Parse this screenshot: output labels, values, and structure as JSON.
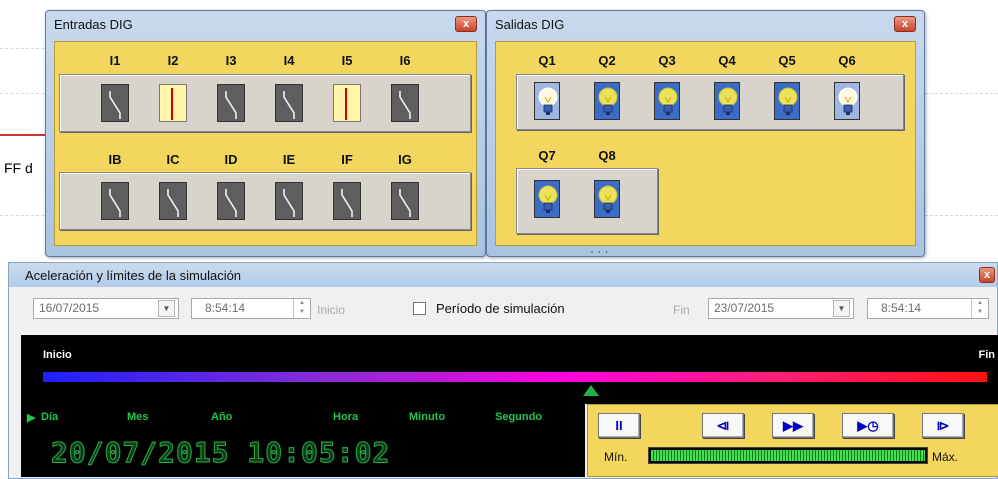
{
  "background": {
    "fragment_text": "FF d"
  },
  "inputs_window": {
    "title": "Entradas DIG",
    "close_label": "x",
    "row1": [
      {
        "label": "I1",
        "state": "off"
      },
      {
        "label": "I2",
        "state": "on"
      },
      {
        "label": "I3",
        "state": "off"
      },
      {
        "label": "I4",
        "state": "off"
      },
      {
        "label": "I5",
        "state": "on"
      },
      {
        "label": "I6",
        "state": "off"
      }
    ],
    "row2": [
      {
        "label": "IB",
        "state": "off"
      },
      {
        "label": "IC",
        "state": "off"
      },
      {
        "label": "ID",
        "state": "off"
      },
      {
        "label": "IE",
        "state": "off"
      },
      {
        "label": "IF",
        "state": "off"
      },
      {
        "label": "IG",
        "state": "off"
      }
    ]
  },
  "outputs_window": {
    "title": "Salidas DIG",
    "close_label": "x",
    "row1": [
      {
        "label": "Q1",
        "state": "on"
      },
      {
        "label": "Q2",
        "state": "off"
      },
      {
        "label": "Q3",
        "state": "off"
      },
      {
        "label": "Q4",
        "state": "off"
      },
      {
        "label": "Q5",
        "state": "off"
      },
      {
        "label": "Q6",
        "state": "on"
      }
    ],
    "row2": [
      {
        "label": "Q7",
        "state": "off"
      },
      {
        "label": "Q8",
        "state": "off"
      }
    ]
  },
  "sim_window": {
    "title": "Aceleración y límites de la simulación",
    "close_label": "x",
    "start_date": "16/07/2015",
    "start_time": "8:54:14",
    "start_label": "Inicio",
    "period_label": "Período de simulación",
    "period_checked": false,
    "end_label": "Fin",
    "end_date": "23/07/2015",
    "end_time": "8:54:14",
    "timeline": {
      "start_label": "Inicio",
      "end_label": "Fin",
      "position_fraction": 0.58
    },
    "clock": {
      "labels": {
        "day": "Día",
        "month": "Mes",
        "year": "Año",
        "hour": "Hora",
        "minute": "Minuto",
        "second": "Segundo"
      },
      "display": "20/07/2015 10:05:02"
    },
    "controls": {
      "pause": "II",
      "step_back": "⧏",
      "fast_forward": "▶▶",
      "play_clock": "▶◷",
      "step_end": "⧐"
    },
    "speed": {
      "min_label": "Mín.",
      "max_label": "Máx.",
      "level_fraction": 1.0
    }
  },
  "colors": {
    "panel_yellow": "#f2d65e",
    "timeline_start": "#2020ff",
    "timeline_end": "#ff1010",
    "lcd_green": "#20c54d"
  }
}
